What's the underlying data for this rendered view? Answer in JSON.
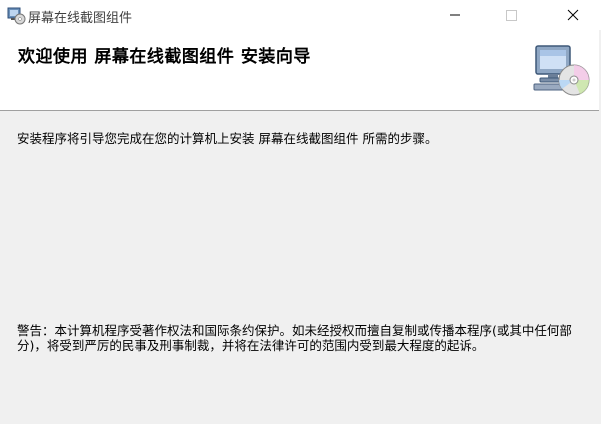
{
  "window": {
    "title": "屏幕在线截图组件",
    "controls": {
      "minimize": "—",
      "maximize": "☐",
      "close": "✕"
    }
  },
  "header": {
    "title": "欢迎使用 屏幕在线截图组件 安装向导",
    "graphic_icon": "computer-cd-icon"
  },
  "body": {
    "intro": "安装程序将引导您完成在您的计算机上安装 屏幕在线截图组件 所需的步骤。",
    "warning": "警告：本计算机程序受著作权法和国际条约保护。如未经授权而擅自复制或传播本程序(或其中任何部分)，将受到严厉的民事及刑事制裁，并将在法律许可的范围内受到最大程度的起诉。"
  },
  "colors": {
    "titlebar_bg": "#ffffff",
    "header_bg": "#ffffff",
    "body_bg": "#f0f0f0"
  }
}
